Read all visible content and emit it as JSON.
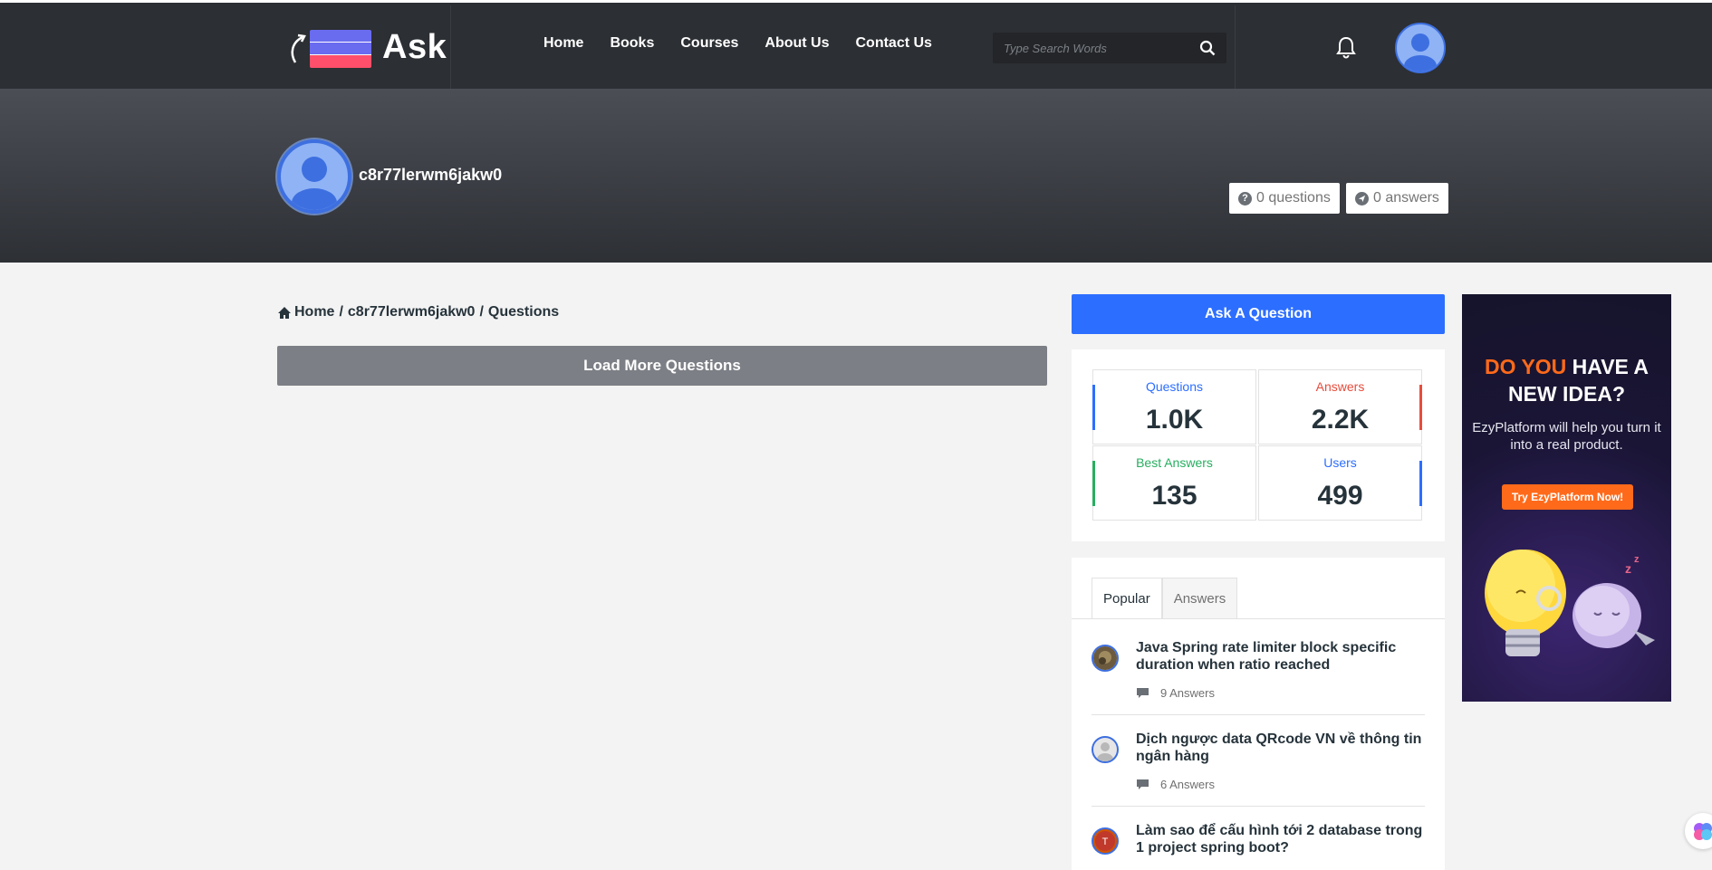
{
  "header": {
    "logo_text": "Ask",
    "nav": [
      "Home",
      "Books",
      "Courses",
      "About Us",
      "Contact Us"
    ],
    "search_placeholder": "Type Search Words"
  },
  "profile": {
    "username": "c8r77lerwm6jakw0",
    "questions_label": "0 questions",
    "answers_label": "0 answers"
  },
  "breadcrumb": {
    "home": "Home",
    "sep1": "/",
    "user": "c8r77lerwm6jakw0",
    "sep2": "/",
    "page": "Questions"
  },
  "main": {
    "load_more_label": "Load More Questions"
  },
  "sidebar": {
    "ask_label": "Ask A Question",
    "stats": [
      {
        "label": "Questions",
        "value": "1.0K",
        "color": "#2c6eff"
      },
      {
        "label": "Answers",
        "value": "2.2K",
        "color": "#e74c3c"
      },
      {
        "label": "Best Answers",
        "value": "135",
        "color": "#27ae60"
      },
      {
        "label": "Users",
        "value": "499",
        "color": "#2c6eff"
      }
    ],
    "tabs": [
      "Popular",
      "Answers"
    ],
    "popular": [
      {
        "title": "Java Spring rate limiter block specific duration when ratio reached",
        "meta": "9 Answers"
      },
      {
        "title": "Dịch ngược data QRcode VN về thông tin ngân hàng",
        "meta": "6 Answers"
      },
      {
        "title": "Làm sao để cấu hình tới 2 database trong 1 project spring boot?",
        "meta": ""
      }
    ]
  },
  "ad": {
    "headline_highlight": "DO YOU",
    "headline_rest_1": " HAVE A",
    "headline_rest_2": "NEW IDEA?",
    "sub": "EzyPlatform will help you turn it into a real product.",
    "button": "Try EzyPlatform Now!"
  }
}
